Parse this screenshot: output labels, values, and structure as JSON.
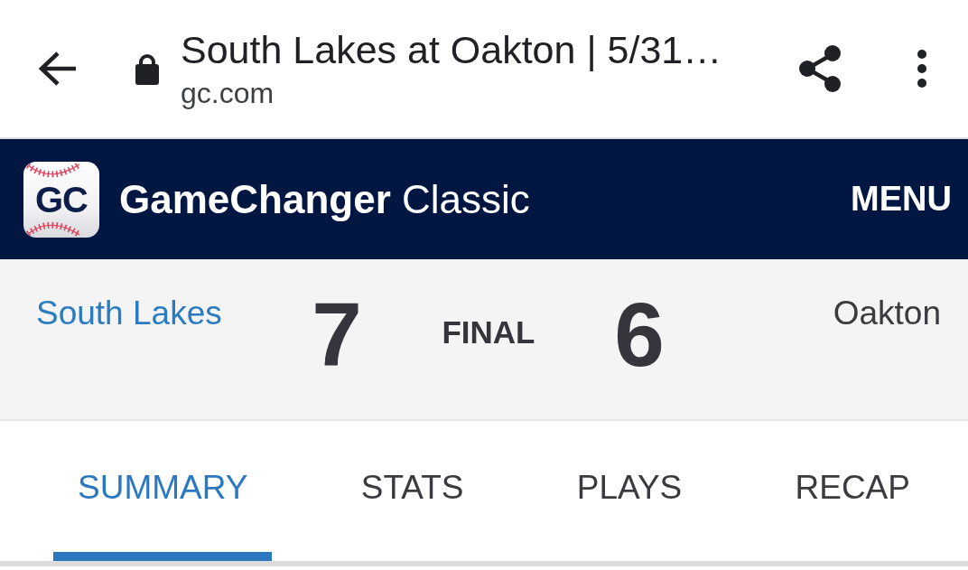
{
  "browser_bar": {
    "page_title": "South Lakes at Oakton | 5/31…",
    "url": "gc.com"
  },
  "site_header": {
    "logo_text": "GC",
    "brand": "**GameChanger** Classic",
    "menu": "MENU"
  },
  "scoreboard": {
    "teams": [
      {
        "name": "South Lakes",
        "score": "7",
        "link": true
      },
      {
        "name": "Oakton",
        "score": "6",
        "link": false
      }
    ],
    "status": "FINAL"
  },
  "tabs": [
    {
      "label": "SUMMARY",
      "selected": true
    },
    {
      "label": "STATS",
      "selected": false
    },
    {
      "label": "PLAYS",
      "selected": false
    },
    {
      "label": "RECAP",
      "selected": false
    }
  ]
}
